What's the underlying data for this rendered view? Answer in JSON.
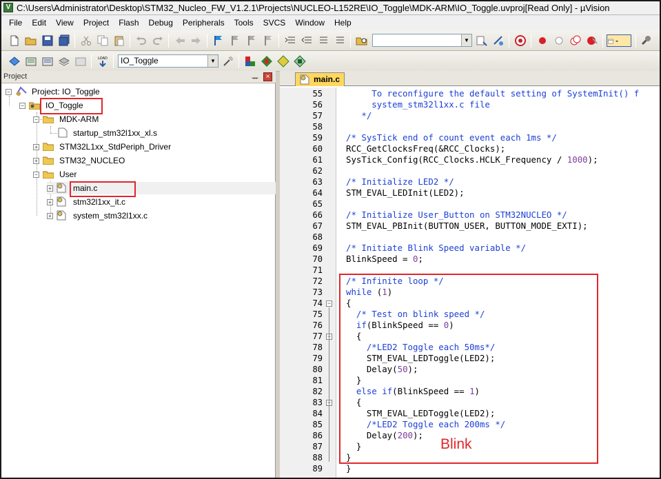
{
  "window": {
    "title": "C:\\Users\\Administrator\\Desktop\\STM32_Nucleo_FW_V1.2.1\\Projects\\NUCLEO-L152RE\\IO_Toggle\\MDK-ARM\\IO_Toggle.uvproj[Read Only]  - µVision"
  },
  "menu": [
    "File",
    "Edit",
    "View",
    "Project",
    "Flash",
    "Debug",
    "Peripherals",
    "Tools",
    "SVCS",
    "Window",
    "Help"
  ],
  "toolbar2": {
    "target_value": "IO_Toggle",
    "load_label": "LOAD"
  },
  "project_pane": {
    "title": "Project",
    "root": "Project: IO_Toggle",
    "target": "IO_Toggle",
    "groups": [
      {
        "name": "MDK-ARM",
        "files": [
          "startup_stm32l1xx_xl.s"
        ]
      },
      {
        "name": "STM32L1xx_StdPeriph_Driver"
      },
      {
        "name": "STM32_NUCLEO"
      },
      {
        "name": "User",
        "files": [
          "main.c",
          "stm32l1xx_it.c",
          "system_stm32l1xx.c"
        ]
      }
    ]
  },
  "editor": {
    "tab": "main.c",
    "line_numbers": [
      "55",
      "56",
      "57",
      "58",
      "59",
      "60",
      "61",
      "62",
      "63",
      "64",
      "65",
      "66",
      "67",
      "68",
      "69",
      "70",
      "71",
      "72",
      "73",
      "74",
      "75",
      "76",
      "77",
      "78",
      "79",
      "80",
      "81",
      "82",
      "83",
      "84",
      "85",
      "86",
      "87",
      "88",
      "89"
    ],
    "lines": [
      "     To reconfigure the default setting of SystemInit() f",
      "     system_stm32l1xx.c file",
      "   */",
      "",
      "/* SysTick end of count event each 1ms */",
      "RCC_GetClocksFreq(&RCC_Clocks);",
      "SysTick_Config(RCC_Clocks.HCLK_Frequency / 1000);",
      "",
      "/* Initialize LED2 */",
      "STM_EVAL_LEDInit(LED2);",
      "",
      "/* Initialize User_Button on STM32NUCLEO */",
      "STM_EVAL_PBInit(BUTTON_USER, BUTTON_MODE_EXTI);",
      "",
      "/* Initiate Blink Speed variable */",
      "BlinkSpeed = 0;",
      "",
      "/* Infinite loop */",
      "while (1)",
      "{",
      "  /* Test on blink speed */",
      "  if(BlinkSpeed == 0)",
      "  {",
      "    /*LED2 Toggle each 50ms*/",
      "    STM_EVAL_LEDToggle(LED2);",
      "    Delay(50);",
      "  }",
      "  else if(BlinkSpeed == 1)",
      "  {",
      "    STM_EVAL_LEDToggle(LED2);",
      "    /*LED2 Toggle each 200ms */",
      "    Delay(200);",
      "  }",
      "}",
      "}"
    ]
  },
  "annotation": {
    "label": "Blink",
    "color": "#e0262b"
  },
  "colors": {
    "comment": "#1c3fd6",
    "number": "#7a3d9a",
    "tab": "#ffd760",
    "highlight": "#e0262b"
  }
}
